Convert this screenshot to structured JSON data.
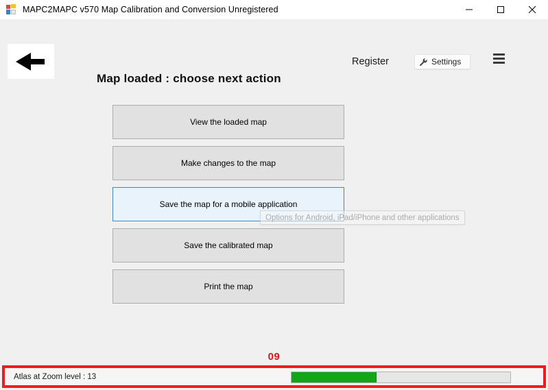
{
  "window": {
    "title": "MAPC2MAPC  v570 Map Calibration and Conversion Unregistered",
    "icon": "app-logo-icon",
    "controls": {
      "minimize": "minimize-icon",
      "maximize": "maximize-icon",
      "close": "close-icon"
    }
  },
  "toolbar": {
    "back_icon": "back-arrow-icon",
    "register_label": "Register",
    "settings_label": "Settings",
    "settings_icon": "wrench-icon",
    "menu_icon": "hamburger-menu-icon"
  },
  "main": {
    "heading": "Map loaded : choose next action",
    "actions": [
      {
        "label": "View the loaded map",
        "state": "normal"
      },
      {
        "label": "Make changes to the map",
        "state": "normal"
      },
      {
        "label": "Save the map for a mobile application",
        "state": "hovered"
      },
      {
        "label": "Save the calibrated map",
        "state": "normal"
      },
      {
        "label": "Print the map",
        "state": "normal"
      }
    ],
    "tooltip": "Options for Android, iPad/iPhone and other applications"
  },
  "status": {
    "counter": "09",
    "text": "Atlas at Zoom level : 13",
    "progress_percent": 39
  },
  "colors": {
    "accent_red": "#ee1c1c",
    "counter_red": "#d41616",
    "progress_green": "#13a616",
    "hover_blue_border": "#3f87c4",
    "hover_blue_fill": "#e8f3fc",
    "window_background": "#f0f0f0",
    "button_face": "#e1e1e1"
  }
}
